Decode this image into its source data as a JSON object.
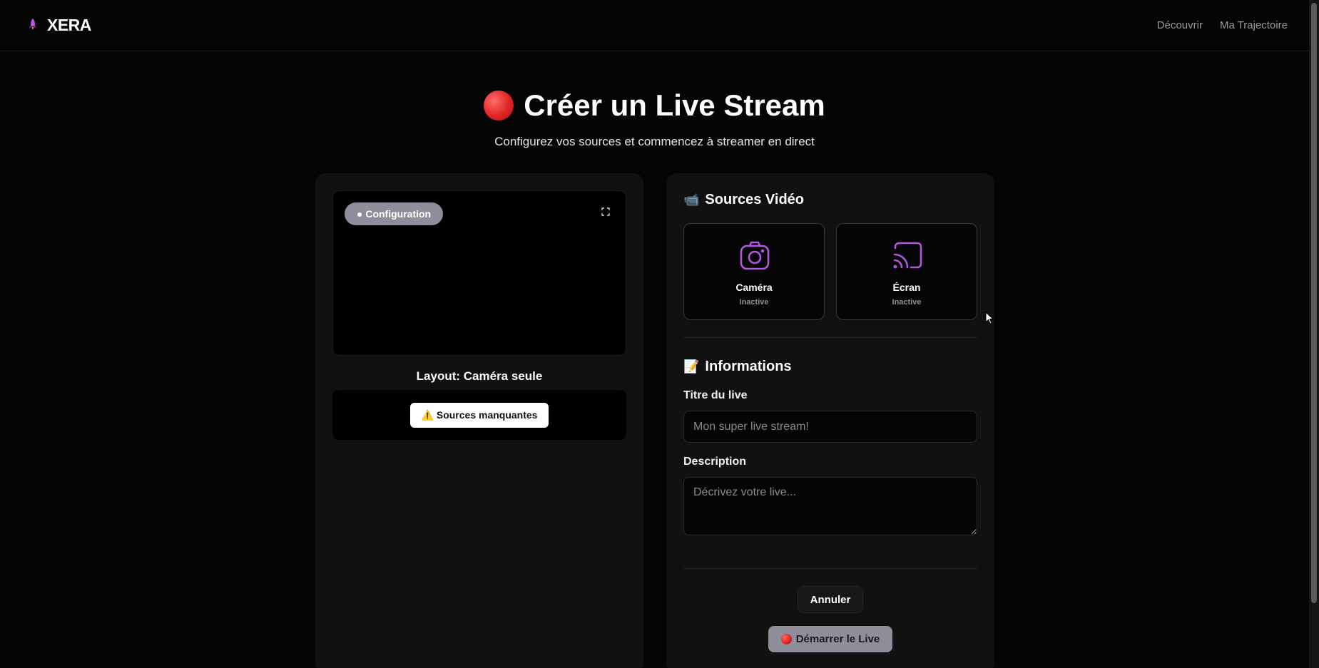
{
  "header": {
    "brand": "XERA",
    "nav": [
      {
        "label": "Découvrir"
      },
      {
        "label": "Ma Trajectoire"
      }
    ]
  },
  "hero": {
    "title": "Créer un Live Stream",
    "subtitle": "Configurez vos sources et commencez à streamer en direct"
  },
  "preview": {
    "status_pill": "● Configuration",
    "layout_label": "Layout: Caméra seule",
    "warning_label": "⚠️ Sources manquantes"
  },
  "sources": {
    "title": "Sources Vidéo",
    "title_emoji": "📹",
    "items": [
      {
        "name": "Caméra",
        "state": "Inactive",
        "icon": "camera-icon"
      },
      {
        "name": "Écran",
        "state": "Inactive",
        "icon": "cast-screen-icon"
      }
    ]
  },
  "info": {
    "title": "Informations",
    "title_emoji": "📝",
    "title_field_label": "Titre du live",
    "title_placeholder": "Mon super live stream!",
    "description_label": "Description",
    "description_placeholder": "Décrivez votre live..."
  },
  "actions": {
    "cancel_label": "Annuler",
    "start_label": "Démarrer le Live"
  },
  "colors": {
    "accent": "#b455e0",
    "background": "#050505",
    "panel": "#111111",
    "pill": "#8e8e9a"
  }
}
